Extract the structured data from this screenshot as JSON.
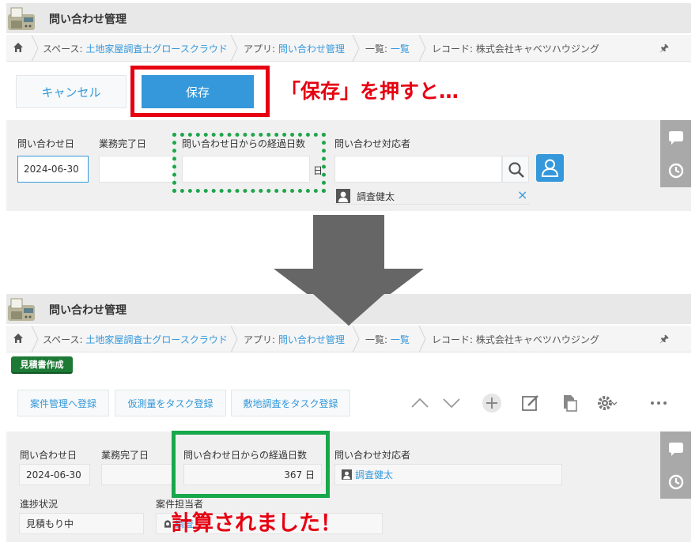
{
  "top": {
    "app_title": "問い合わせ管理",
    "breadcrumb": {
      "space_prefix": "スペース: ",
      "space_link": "土地家屋調査士グロースクラウド",
      "app_prefix": "アプリ: ",
      "app_link": "問い合わせ管理",
      "list_prefix": "一覧: ",
      "list_link": "一覧",
      "record": "レコード: 株式会社キャベツハウジング"
    },
    "cancel_label": "キャンセル",
    "save_label": "保存",
    "annotation": "「保存」を押すと…",
    "fields": {
      "inquiry_date_label": "問い合わせ日",
      "inquiry_date_value": "2024-06-30",
      "completion_date_label": "業務完了日",
      "elapsed_days_label": "問い合わせ日からの経過日数",
      "elapsed_unit": "日",
      "assignee_label": "問い合わせ対応者",
      "assignee_name": "調査健太",
      "remove_glyph": "×"
    }
  },
  "bottom": {
    "app_title": "問い合わせ管理",
    "breadcrumb": {
      "space_prefix": "スペース: ",
      "space_link": "土地家屋調査士グロースクラウド",
      "app_prefix": "アプリ: ",
      "app_link": "問い合わせ管理",
      "list_prefix": "一覧: ",
      "list_link": "一覧",
      "record": "レコード: 株式会社キャベツハウジング"
    },
    "estimate_button": "見積書作成",
    "actions": [
      "案件管理へ登録",
      "仮測量をタスク登録",
      "敷地調査をタスク登録"
    ],
    "fields": {
      "inquiry_date_label": "問い合わせ日",
      "inquiry_date_value": "2024-06-30",
      "completion_date_label": "業務完了日",
      "elapsed_days_label": "問い合わせ日からの経過日数",
      "elapsed_days_value": "367 日",
      "assignee_label": "問い合わせ対応者",
      "assignee_name": "調査健太",
      "status_label": "進捗状況",
      "status_value": "見積もり中",
      "case_owner_label": "案件担当者",
      "case_owner_partial": "調査"
    },
    "annotation": "計算されました！"
  },
  "colors": {
    "accent": "#3498db",
    "red": "#e60012",
    "green_box": "#17a84b",
    "green_dotted": "#1ea64a",
    "arrow": "#666666"
  }
}
